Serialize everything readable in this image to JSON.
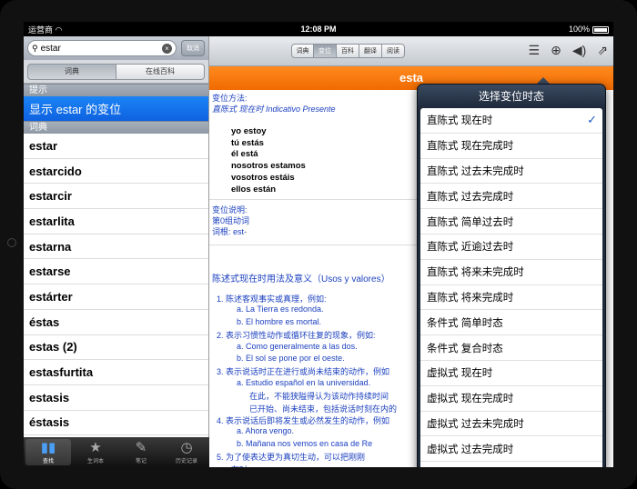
{
  "status": {
    "carrier": "运营商",
    "time": "12:08 PM",
    "battery": "100%"
  },
  "search": {
    "value": "estar",
    "cancel": "取消"
  },
  "left_seg": [
    "词典",
    "在线百科"
  ],
  "hint_header": "提示",
  "hint_row": "显示 estar 的变位",
  "dict_header": "词典",
  "words": [
    "estar",
    "estarcido",
    "estarcir",
    "estarlita",
    "estarna",
    "estarse",
    "estárter",
    "éstas",
    "estas (2)",
    "estasfurtita",
    "estasis",
    "éstasis"
  ],
  "tabbar": [
    {
      "label": "查找",
      "icon": "book-icon"
    },
    {
      "label": "生词本",
      "icon": "star-icon"
    },
    {
      "label": "笔记",
      "icon": "note-icon"
    },
    {
      "label": "历史记录",
      "icon": "clock-icon"
    }
  ],
  "toolbar_segs": [
    "词典",
    "变位",
    "百科",
    "翻译",
    "阅读"
  ],
  "title_bar": "esta",
  "content": {
    "method_label": "变位方法:",
    "method_value": "直陈式 现在时 Indicativo Presente",
    "conj": [
      "yo estoy",
      "tú estás",
      "él está",
      "nosotros estamos",
      "vosotros estáis",
      "ellos están"
    ],
    "note_label": "变位说明:",
    "note_group": "第0组动词",
    "note_root": "词根: est-",
    "usage_title": "陈述式现在时用法及意义（Usos y valores）",
    "usage": [
      "1.    陈述客观事实或真理，例如:",
      "a.       La Tierra es redonda.",
      "b.       El hombre es mortal.",
      "2.   表示习惯性动作或循环往复的现象，例如:",
      "a.       Como generalmente a las dos.",
      "b.       El sol se pone por el oeste.",
      "3.   表示说话时正在进行或尚未结束的动作，例如",
      "a.       Estudio español en la universidad.",
      "在此，不能狭隘得认为该动作持续时间",
      "已开始、尚未结束，包括说话时刻在内的",
      "4.   表示说话后即将发生或必然发生的动作，例如",
      "a.       Ahora vengo.",
      "b.       Mañana nos vemos en casa de Re",
      "5.      为了使表达更为真切生动，可以把刚刚",
      "在时。"
    ]
  },
  "popover": {
    "title": "选择变位时态",
    "items": [
      "直陈式  现在时",
      "直陈式  现在完成时",
      "直陈式   过去未完成时",
      "直陈式  过去完成时",
      "直陈式  简单过去时",
      "直陈式  近逾过去时",
      "直陈式  将来未完成时",
      "直陈式  将来完成时",
      "条件式  简单时态",
      "条件式  复合时态",
      "虚拟式  现在时",
      "虚拟式  现在完成时",
      "虚拟式  过去未完成时",
      "虚拟式  过去完成时"
    ],
    "checked_index": 0,
    "check": "✓"
  }
}
